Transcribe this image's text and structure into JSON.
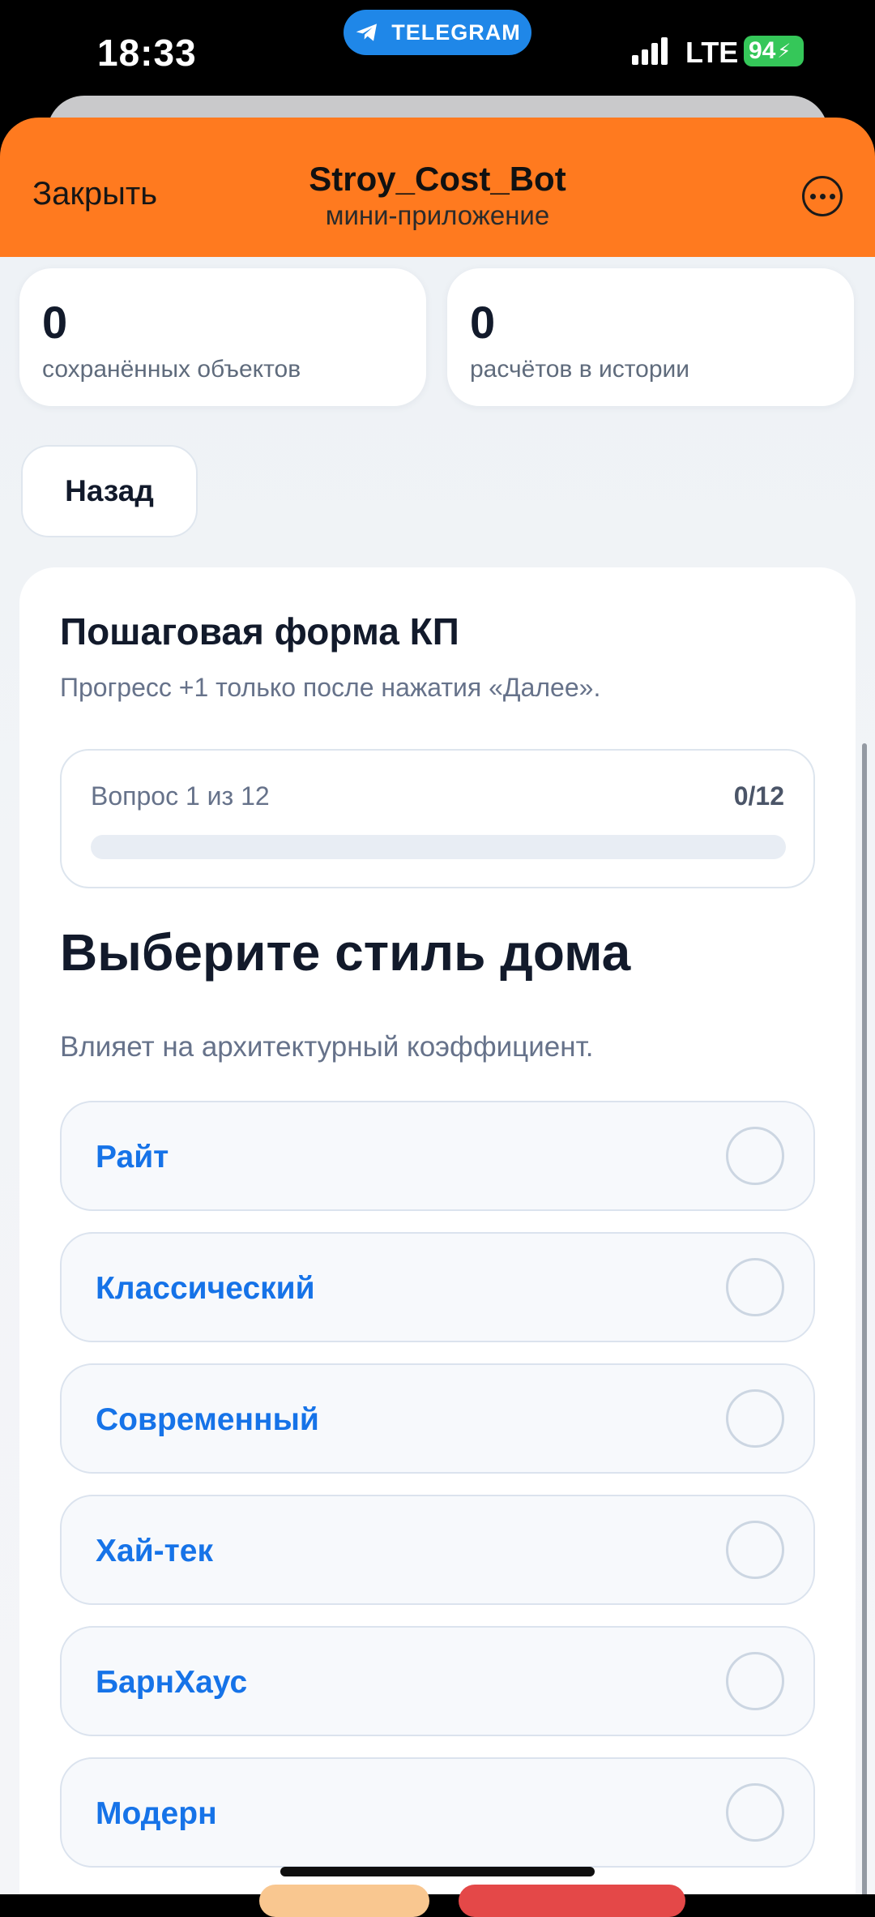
{
  "status_bar": {
    "time": "18:33",
    "telegram_pill": "TELEGRAM",
    "network": "LTE",
    "battery": "94"
  },
  "header": {
    "close_label": "Закрыть",
    "title": "Stroy_Cost_Bot",
    "subtitle": "мини-приложение",
    "more_icon": "more-dots-icon"
  },
  "stats": [
    {
      "value": "0",
      "label": "сохранённых объектов"
    },
    {
      "value": "0",
      "label": "расчётов в истории"
    }
  ],
  "back_label": "Назад",
  "form": {
    "title": "Пошаговая форма КП",
    "subtitle": "Прогресс +1 только после нажатия «Далее».",
    "progress": {
      "question_label": "Вопрос 1 из 12",
      "count_label": "0/12",
      "fraction": 0
    },
    "question": "Выберите стиль дома",
    "hint": "Влияет на архитектурный коэффициент.",
    "options": [
      "Райт",
      "Классический",
      "Современный",
      "Хай-тек",
      "БарнХаус",
      "Модерн"
    ]
  },
  "colors": {
    "header": "#ff7a1f",
    "accent": "#1673e8",
    "telegram": "#1f87e8",
    "battery": "#35c759"
  }
}
